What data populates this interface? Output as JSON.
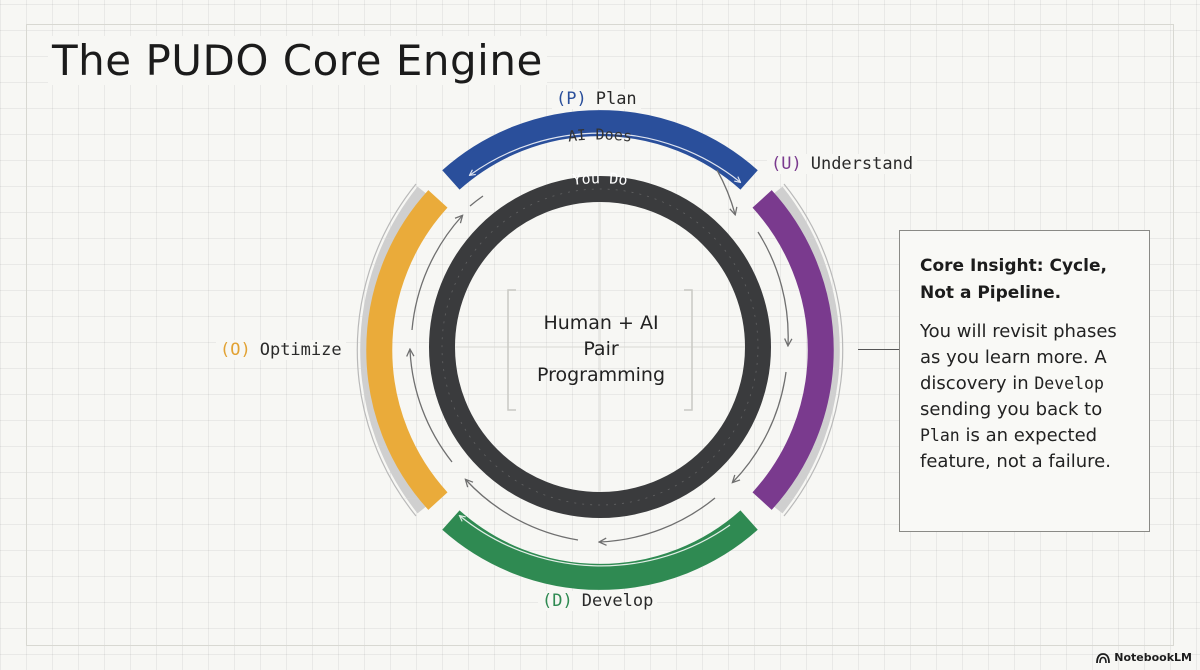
{
  "title": "The PUDO Core Engine",
  "phases": {
    "plan": {
      "code": "(P)",
      "name": "Plan",
      "color": "#2a4f9b"
    },
    "understand": {
      "code": "(U)",
      "name": "Understand",
      "color": "#7a3a8e"
    },
    "develop": {
      "code": "(D)",
      "name": "Develop",
      "color": "#2f8a52"
    },
    "optimize": {
      "code": "(O)",
      "name": "Optimize",
      "color": "#eaab3a"
    }
  },
  "rings": {
    "ai_label": "AI Does",
    "you_label": "You Do",
    "inner_ring_color": "#3a3b3d",
    "shadow_ring_color": "#cccccc"
  },
  "center": {
    "lines": [
      "Human + AI",
      "Pair",
      "Programming"
    ]
  },
  "callout": {
    "title": "Core Insight: Cycle, Not a Pipeline.",
    "body": {
      "p1": "You will revisit phases as you learn more. A discovery in ",
      "code1": "Develop",
      "p2": " sending you back to ",
      "code2": "Plan",
      "p3": " is an expected feature, not a failure."
    }
  },
  "brand": {
    "name": "NotebookLM",
    "icon": "notebooklm-logo-icon"
  }
}
